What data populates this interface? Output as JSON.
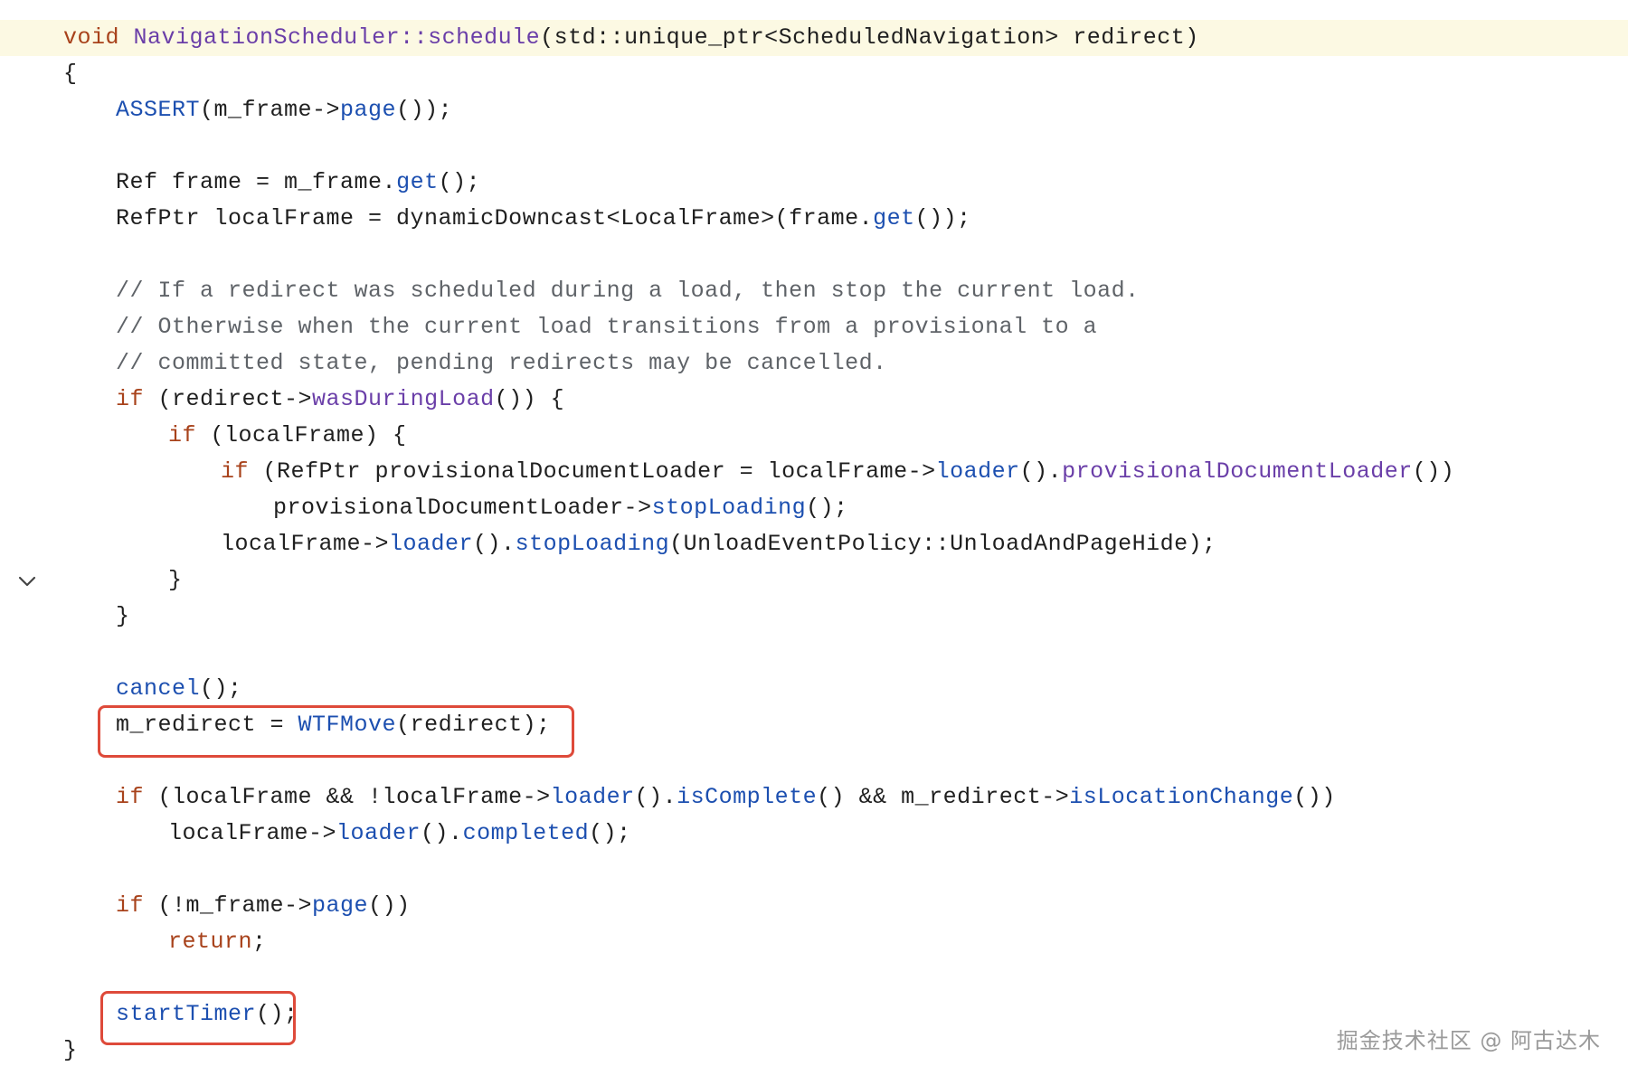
{
  "editor": {
    "lines": [
      {
        "indent": 0,
        "highlight": true,
        "tokens": [
          {
            "t": "void",
            "c": "kw"
          },
          {
            "t": " ",
            "c": "pl"
          },
          {
            "t": "NavigationScheduler::schedule",
            "c": "cls"
          },
          {
            "t": "(std::unique_ptr<ScheduledNavigation> redirect)",
            "c": "pl"
          }
        ]
      },
      {
        "indent": 0,
        "tokens": [
          {
            "t": "{",
            "c": "pl"
          }
        ]
      },
      {
        "indent": 1,
        "tokens": [
          {
            "t": "ASSERT",
            "c": "fn"
          },
          {
            "t": "(m_frame->",
            "c": "pl"
          },
          {
            "t": "page",
            "c": "fn"
          },
          {
            "t": "());",
            "c": "pl"
          }
        ]
      },
      {
        "indent": 0,
        "tokens": []
      },
      {
        "indent": 1,
        "tokens": [
          {
            "t": "Ref frame = m_frame.",
            "c": "pl"
          },
          {
            "t": "get",
            "c": "fn"
          },
          {
            "t": "();",
            "c": "pl"
          }
        ]
      },
      {
        "indent": 1,
        "tokens": [
          {
            "t": "RefPtr localFrame = dynamicDowncast<LocalFrame>(frame.",
            "c": "pl"
          },
          {
            "t": "get",
            "c": "fn"
          },
          {
            "t": "());",
            "c": "pl"
          }
        ]
      },
      {
        "indent": 0,
        "tokens": []
      },
      {
        "indent": 1,
        "tokens": [
          {
            "t": "// If a redirect was scheduled during a load, then stop the current load.",
            "c": "cm"
          }
        ]
      },
      {
        "indent": 1,
        "tokens": [
          {
            "t": "// Otherwise when the current load transitions from a provisional to a",
            "c": "cm"
          }
        ]
      },
      {
        "indent": 1,
        "tokens": [
          {
            "t": "// committed state, pending redirects may be cancelled.",
            "c": "cm"
          }
        ]
      },
      {
        "indent": 1,
        "tokens": [
          {
            "t": "if",
            "c": "kw"
          },
          {
            "t": " (redirect->",
            "c": "pl"
          },
          {
            "t": "wasDuringLoad",
            "c": "cls"
          },
          {
            "t": "()) {",
            "c": "pl"
          }
        ]
      },
      {
        "indent": 2,
        "tokens": [
          {
            "t": "if",
            "c": "kw"
          },
          {
            "t": " (localFrame) {",
            "c": "pl"
          }
        ]
      },
      {
        "indent": 3,
        "tokens": [
          {
            "t": "if",
            "c": "kw"
          },
          {
            "t": " (RefPtr provisionalDocumentLoader = localFrame->",
            "c": "pl"
          },
          {
            "t": "loader",
            "c": "fn"
          },
          {
            "t": "().",
            "c": "pl"
          },
          {
            "t": "provisionalDocumentLoader",
            "c": "cls"
          },
          {
            "t": "())",
            "c": "pl"
          }
        ]
      },
      {
        "indent": 4,
        "tokens": [
          {
            "t": "provisionalDocumentLoader->",
            "c": "pl"
          },
          {
            "t": "stopLoading",
            "c": "fn"
          },
          {
            "t": "();",
            "c": "pl"
          }
        ]
      },
      {
        "indent": 3,
        "tokens": [
          {
            "t": "localFrame->",
            "c": "pl"
          },
          {
            "t": "loader",
            "c": "fn"
          },
          {
            "t": "().",
            "c": "pl"
          },
          {
            "t": "stopLoading",
            "c": "fn"
          },
          {
            "t": "(UnloadEventPolicy::UnloadAndPageHide);",
            "c": "pl"
          }
        ]
      },
      {
        "indent": 2,
        "fold": true,
        "tokens": [
          {
            "t": "}",
            "c": "pl"
          }
        ]
      },
      {
        "indent": 1,
        "tokens": [
          {
            "t": "}",
            "c": "pl"
          }
        ]
      },
      {
        "indent": 0,
        "tokens": []
      },
      {
        "indent": 1,
        "tokens": [
          {
            "t": "cancel",
            "c": "fn"
          },
          {
            "t": "();",
            "c": "pl"
          }
        ]
      },
      {
        "indent": 1,
        "tokens": [
          {
            "t": "m_redirect = ",
            "c": "pl"
          },
          {
            "t": "WTFMove",
            "c": "fn"
          },
          {
            "t": "(redirect);",
            "c": "pl"
          }
        ]
      },
      {
        "indent": 0,
        "tokens": []
      },
      {
        "indent": 1,
        "tokens": [
          {
            "t": "if",
            "c": "kw"
          },
          {
            "t": " (localFrame && !localFrame->",
            "c": "pl"
          },
          {
            "t": "loader",
            "c": "fn"
          },
          {
            "t": "().",
            "c": "pl"
          },
          {
            "t": "isComplete",
            "c": "fn"
          },
          {
            "t": "() && m_redirect->",
            "c": "pl"
          },
          {
            "t": "isLocationChange",
            "c": "fn"
          },
          {
            "t": "())",
            "c": "pl"
          }
        ]
      },
      {
        "indent": 2,
        "tokens": [
          {
            "t": "localFrame->",
            "c": "pl"
          },
          {
            "t": "loader",
            "c": "fn"
          },
          {
            "t": "().",
            "c": "pl"
          },
          {
            "t": "completed",
            "c": "fn"
          },
          {
            "t": "();",
            "c": "pl"
          }
        ]
      },
      {
        "indent": 0,
        "tokens": []
      },
      {
        "indent": 1,
        "tokens": [
          {
            "t": "if",
            "c": "kw"
          },
          {
            "t": " (!m_frame->",
            "c": "pl"
          },
          {
            "t": "page",
            "c": "fn"
          },
          {
            "t": "())",
            "c": "pl"
          }
        ]
      },
      {
        "indent": 2,
        "tokens": [
          {
            "t": "return",
            "c": "kw"
          },
          {
            "t": ";",
            "c": "pl"
          }
        ]
      },
      {
        "indent": 0,
        "tokens": []
      },
      {
        "indent": 1,
        "tokens": [
          {
            "t": "startTimer",
            "c": "fn"
          },
          {
            "t": "();",
            "c": "pl"
          }
        ]
      },
      {
        "indent": 0,
        "tokens": [
          {
            "t": "}",
            "c": "pl"
          }
        ]
      }
    ],
    "fold_icon": "chevron-down-icon",
    "annotation_color": "#de4a3a"
  },
  "watermark": "掘金技术社区 @ 阿古达木"
}
